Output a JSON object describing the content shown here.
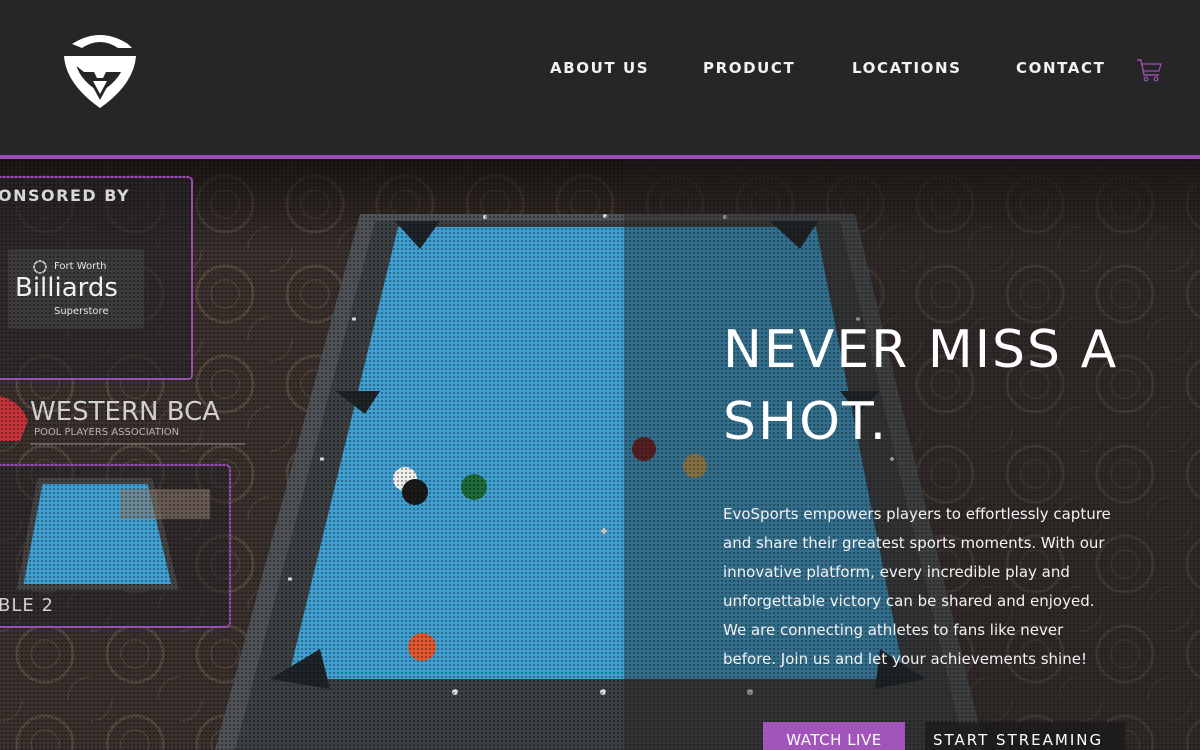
{
  "brand": {
    "logo_icon": "evosports-logo-icon",
    "accent": "#9b4fb5"
  },
  "nav": {
    "about": "ABOUT US",
    "product": "PRODUCT",
    "locations": "LOCATIONS",
    "contact": "CONTACT",
    "cart_icon": "cart-icon"
  },
  "overlay": {
    "sponsored_by": "ONSORED BY",
    "sponsor1_line1": "Fort Worth",
    "sponsor1_line2": "Billiards",
    "sponsor1_line3": "Superstore",
    "sponsor2_name": "WESTERN BCA",
    "sponsor2_sub": "POOL PLAYERS ASSOCIATION",
    "table_label": "BLE 2"
  },
  "hero": {
    "title_line1": "NEVER MISS A",
    "title_line2": "SHOT.",
    "body": "EvoSports empowers players to effortlessly capture and share their greatest sports moments. With our innovative platform, every incredible play and unforgettable victory can be shared and enjoyed. We are connecting athletes to fans like never before. Join us and let your achievements shine!",
    "watch_live": "WATCH LIVE",
    "start_streaming": "START STREAMING"
  }
}
